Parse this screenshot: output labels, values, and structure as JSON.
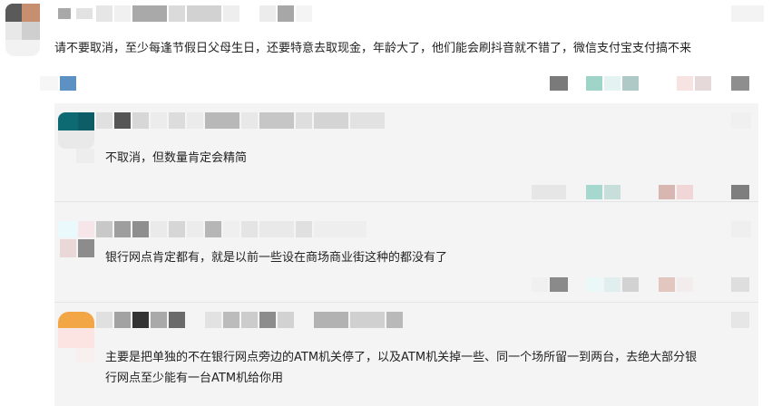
{
  "comments": [
    {
      "id": "main",
      "text": "请不要取消，至少每逢节假日父母生日，还要特意去取现金，年龄大了，他们能会刷抖音就不错了，微信支付宝支付搞不来"
    }
  ],
  "replies": [
    {
      "id": "reply-1",
      "text": "不取消，但数量肯定会精简"
    },
    {
      "id": "reply-2",
      "text": "银行网点肯定都有，就是以前一些设在商场商业街这种的都没有了"
    },
    {
      "id": "reply-3",
      "line1": "主要是把单独的不在银行网点旁边的ATM机关停了，以及ATM机关掉一些、同一个场所留一到两台，去绝大部分银",
      "line2": "行网点至少能有一台ATM机给你用"
    }
  ],
  "colors": {
    "reply_bg": "#f4f4f4",
    "mosaic_dark": "#3a3a3a",
    "mosaic_mid": "#8f8f8f",
    "mosaic_light": "#d9d9d9",
    "teal": "#0e6a72",
    "blue": "#5d91c4",
    "orange": "#f2a645"
  }
}
